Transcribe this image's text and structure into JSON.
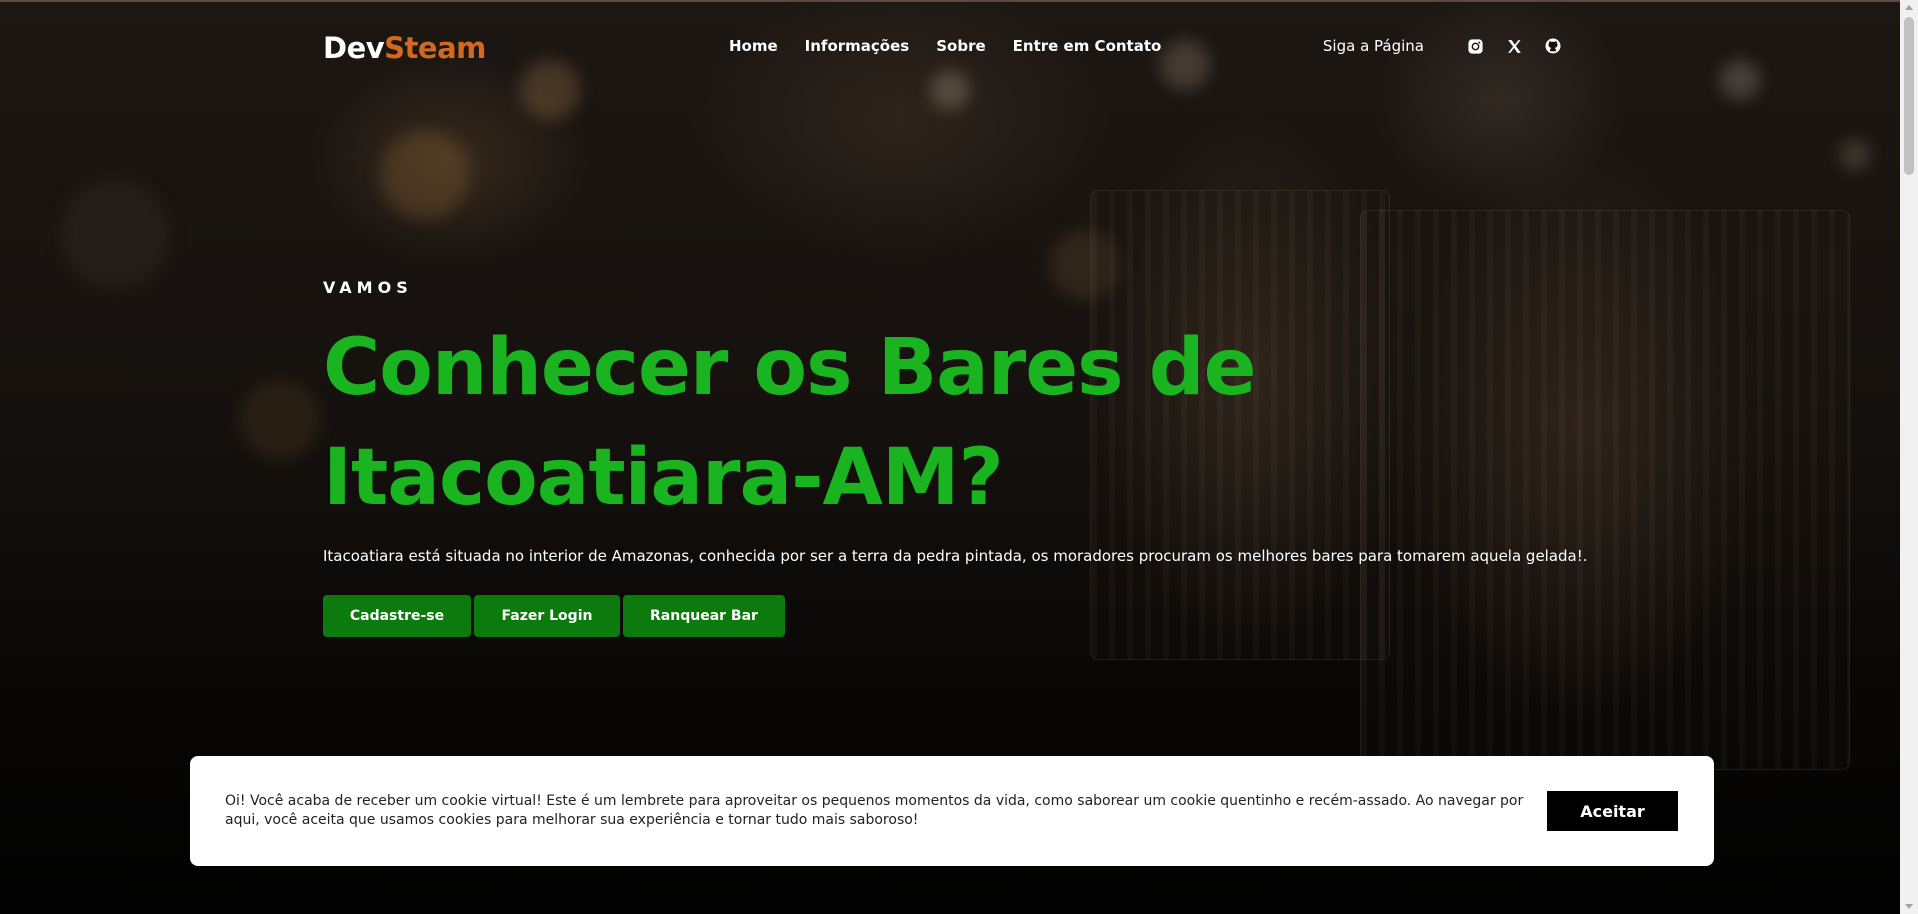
{
  "brand": {
    "part1": "Dev",
    "part2": "Steam",
    "color_part2": "#d2691e"
  },
  "nav": {
    "links": [
      "Home",
      "Informações",
      "Sobre",
      "Entre em Contato"
    ]
  },
  "social": {
    "label": "Siga a Página",
    "icons": [
      "instagram-icon",
      "x-icon",
      "github-icon"
    ]
  },
  "hero": {
    "eyebrow": "VAMOS",
    "headline": "Conhecer os Bares de Itacoatiara-AM?",
    "headline_color": "#19b41f",
    "description": "Itacoatiara está situada no interior de Amazonas, conhecida por ser a terra da pedra pintada, os moradores procuram os melhores bares para tomarem aquela gelada!.",
    "buttons": [
      "Cadastre-se",
      "Fazer Login",
      "Ranquear Bar"
    ],
    "button_color": "#0d7a0d"
  },
  "cookie": {
    "text": "Oi! Você acaba de receber um cookie virtual! Este é um lembrete para aproveitar os pequenos momentos da vida, como saborear um cookie quentinho e recém-assado. Ao navegar por aqui, você aceita que usamos cookies para melhorar sua experiência e tornar tudo mais saboroso!",
    "accept": "Aceitar"
  }
}
